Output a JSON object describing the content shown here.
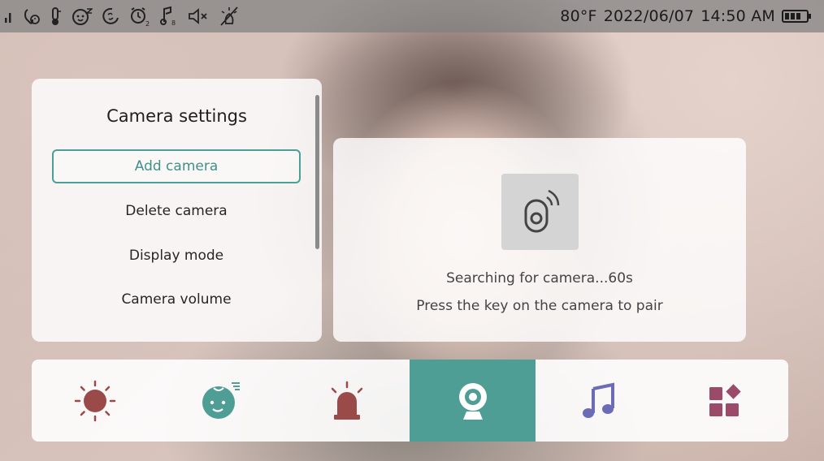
{
  "status_bar": {
    "icons": [
      "signal-icon",
      "power-saving-icon",
      "temperature-alert-icon",
      "baby-face-icon",
      "lullaby-timer-icon",
      "alarm-icon",
      "volume-sensitivity-icon",
      "mute-icon",
      "night-light-off-icon"
    ],
    "temperature": "80°F",
    "date": "2022/06/07",
    "time": "14:50 AM",
    "battery": "battery-icon"
  },
  "settings": {
    "title": "Camera settings",
    "items": [
      {
        "label": "Add camera",
        "selected": true
      },
      {
        "label": "Delete camera",
        "selected": false
      },
      {
        "label": "Display mode",
        "selected": false
      },
      {
        "label": "Camera volume",
        "selected": false
      }
    ]
  },
  "pairing": {
    "icon": "camera-pairing-icon",
    "status": "Searching for camera...60s",
    "instruction": "Press the key on the camera to pair"
  },
  "nav": {
    "items": [
      {
        "icon": "brightness-icon",
        "color": "#9b4a4a",
        "active": false
      },
      {
        "icon": "baby-icon",
        "color": "#4f9e96",
        "active": false
      },
      {
        "icon": "alarm-light-icon",
        "color": "#9b4a4a",
        "active": false
      },
      {
        "icon": "camera-icon",
        "color": "#ffffff",
        "active": true
      },
      {
        "icon": "music-icon",
        "color": "#6b6cb5",
        "active": false
      },
      {
        "icon": "apps-icon",
        "color": "#9b4a6a",
        "active": false
      }
    ]
  },
  "colors": {
    "accent": "#4f9e96",
    "status_bar": "#808080",
    "panel": "#ffffff"
  }
}
